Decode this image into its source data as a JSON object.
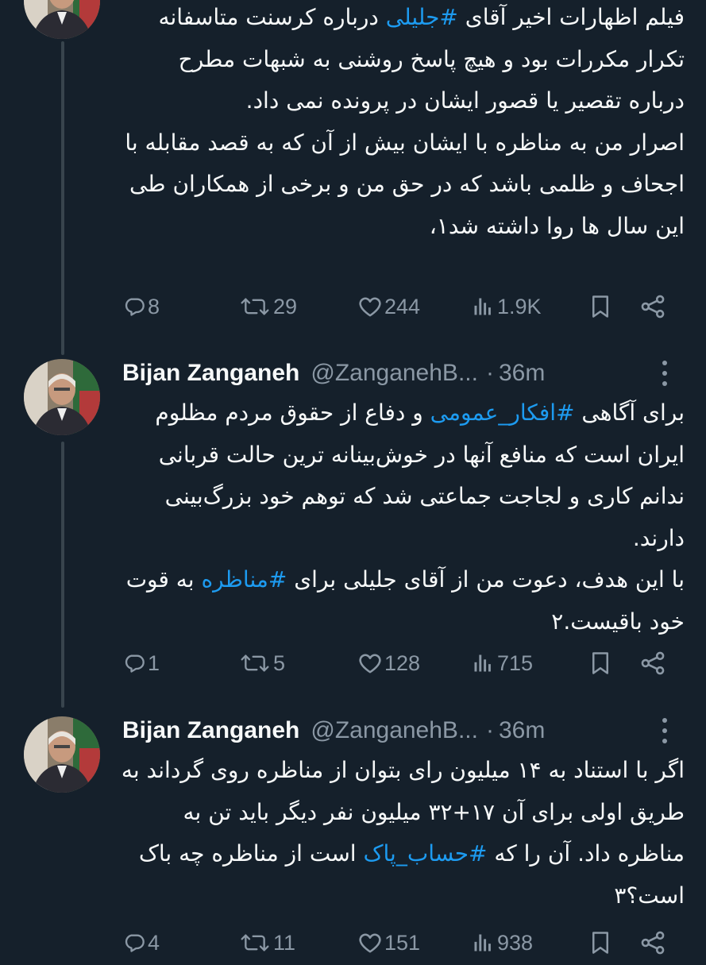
{
  "tweets": [
    {
      "author": {
        "name": "",
        "handle": "",
        "time": ""
      },
      "paragraphs": [
        [
          {
            "text": "فیلم اظهارات اخیر آقای "
          },
          {
            "text": "#جلیلی",
            "hashtag": true
          },
          {
            "text": " درباره کرسنت متاسفانه تکرار مکررات بود و هیچ پاسخ روشنی به شبهات مطرح درباره تقصیر یا قصور ایشان در پرونده نمی داد."
          }
        ],
        [
          {
            "text": "اصرار من به مناظره با ایشان بیش از آن که به قصد مقابله با اجحاف و ظلمی باشد که در حق من و برخی از همکاران طی این سال ها روا داشته شد۱،"
          }
        ]
      ],
      "stats": {
        "replies": "8",
        "retweets": "29",
        "likes": "244",
        "views": "1.9K"
      }
    },
    {
      "author": {
        "name": "Bijan Zanganeh",
        "handle": "@ZanganehB...",
        "time": "36m"
      },
      "paragraphs": [
        [
          {
            "text": "برای آگاهی "
          },
          {
            "text": "#افکار_عمومی",
            "hashtag": true
          },
          {
            "text": " و دفاع از حقوق مردم مظلوم ایران است که منافع آنها در خوش‌بینانه ترین حالت قربانی ندانم کاری و لجاجت جماعتی شد که توهم خود بزرگ‌بینی دارند."
          }
        ],
        [
          {
            "text": "با این هدف، دعوت من از آقای جلیلی برای "
          },
          {
            "text": "#مناظره",
            "hashtag": true
          },
          {
            "text": " به قوت خود باقیست.۲"
          }
        ]
      ],
      "stats": {
        "replies": "1",
        "retweets": "5",
        "likes": "128",
        "views": "715"
      }
    },
    {
      "author": {
        "name": "Bijan Zanganeh",
        "handle": "@ZanganehB...",
        "time": "36m"
      },
      "paragraphs": [
        [
          {
            "text": "اگر با استناد به ۱۴ میلیون رای بتوان از مناظره روی گرداند به طریق اولی برای آن ۱۷+۳۲ میلیون نفر دیگر باید تن به مناظره داد. آن را که "
          },
          {
            "text": "#حساب_پاک",
            "hashtag": true
          },
          {
            "text": " است از مناظره چه باک است؟۳"
          }
        ]
      ],
      "stats": {
        "replies": "4",
        "retweets": "11",
        "likes": "151",
        "views": "938"
      }
    }
  ],
  "icons": {
    "reply": "reply-icon",
    "retweet": "retweet-icon",
    "like": "heart-icon",
    "views": "views-icon",
    "bookmark": "bookmark-icon",
    "share": "share-icon",
    "more": "more-icon"
  },
  "colors": {
    "background": "#15202b",
    "text": "#f7f9f9",
    "secondary": "#8b98a5",
    "link": "#1d9bf0",
    "thread_line": "#38444d"
  }
}
